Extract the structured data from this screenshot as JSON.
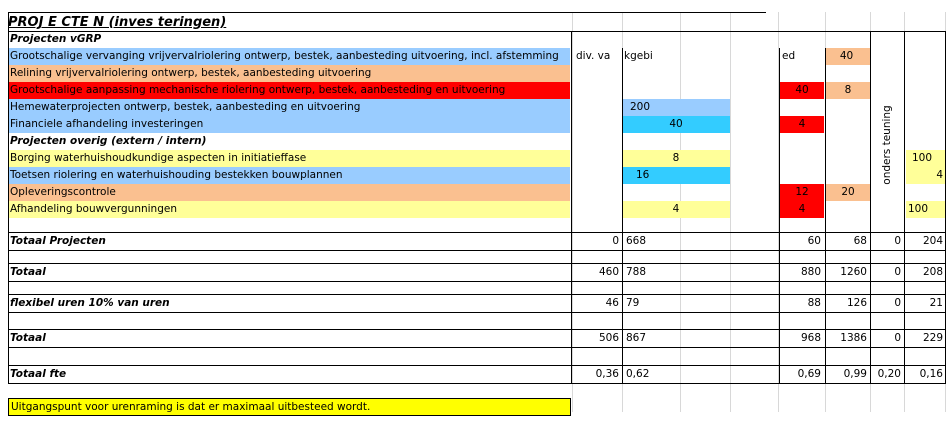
{
  "title": "PROJ E CTE N (inves teringen)",
  "colors": {
    "blue": "#99ccff",
    "cyan": "#33ccff",
    "salmon": "#fac090",
    "red": "#ff0000",
    "yellow_light": "#ffff99",
    "yellow": "#ffff00"
  },
  "headers": {
    "vgrp": "Projecten vGRP",
    "overig": "Projecten overig (extern / intern)"
  },
  "col_headers": {
    "div": "div. va",
    "kgebi": "kgebi",
    "ed": "ed",
    "ondersteuning": "onders teuning"
  },
  "rows": [
    {
      "label": "Grootschalige vervanging vrijvervalriolering ontwerp, bestek, aanbesteding uitvoering, incl. afstemming",
      "col3": "",
      "col4": "",
      "col5": "40",
      "col6": "",
      "col7": ""
    },
    {
      "label": "Relining vrijvervalriolering ontwerp, bestek, aanbesteding uitvoering",
      "col3": "",
      "col4": "",
      "col5": "",
      "col6": "",
      "col7": ""
    },
    {
      "label": "Grootschalige aanpassing mechanische riolering ontwerp, bestek, aanbesteding en uitvoering",
      "col3": "",
      "col4": "40",
      "col5": "8",
      "col6": "",
      "col7": ""
    },
    {
      "label": "Hemewaterprojecten ontwerp, bestek, aanbesteding en uitvoering",
      "col3": "200",
      "col4": "",
      "col5": "",
      "col6": "",
      "col7": ""
    },
    {
      "label": "Financiele afhandeling investeringen",
      "col3": "40",
      "col4": "4",
      "col5": "",
      "col6": "",
      "col7": ""
    },
    {
      "label": "Borging waterhuishoudkundige aspecten in initiatieffase",
      "col3": "8",
      "col4": "",
      "col5": "",
      "col6": "",
      "col7": "100"
    },
    {
      "label": "Toetsen riolering en waterhuishouding bestekken bouwplannen",
      "col3": "16",
      "col4": "",
      "col5": "",
      "col6": "",
      "col7": "4"
    },
    {
      "label": "Opleveringscontrole",
      "col3": "",
      "col4": "12",
      "col5": "20",
      "col6": "",
      "col7": ""
    },
    {
      "label": "Afhandeling bouwvergunningen",
      "col3": "4",
      "col4": "4",
      "col5": "",
      "col6": "",
      "col7": "100"
    }
  ],
  "totals": [
    {
      "label": "Totaal Projecten",
      "c1": "0",
      "c2": "668",
      "c3": "60",
      "c4": "68",
      "c5": "0",
      "c6": "204"
    },
    {
      "label": "Totaal",
      "c1": "460",
      "c2": "788",
      "c3": "880",
      "c4": "1260",
      "c5": "0",
      "c6": "208"
    },
    {
      "label": "flexibel uren 10% van uren",
      "c1": "46",
      "c2": "79",
      "c3": "88",
      "c4": "126",
      "c5": "0",
      "c6": "21"
    },
    {
      "label": "Totaal",
      "c1": "506",
      "c2": "867",
      "c3": "968",
      "c4": "1386",
      "c5": "0",
      "c6": "229"
    },
    {
      "label": "Totaal fte",
      "c1": "0,36",
      "c2": "0,62",
      "c3": "0,69",
      "c4": "0,99",
      "c5": "0,20",
      "c6": "0,16"
    }
  ],
  "note": "Uitgangspunt voor urenraming is dat er maximaal uitbesteed wordt."
}
